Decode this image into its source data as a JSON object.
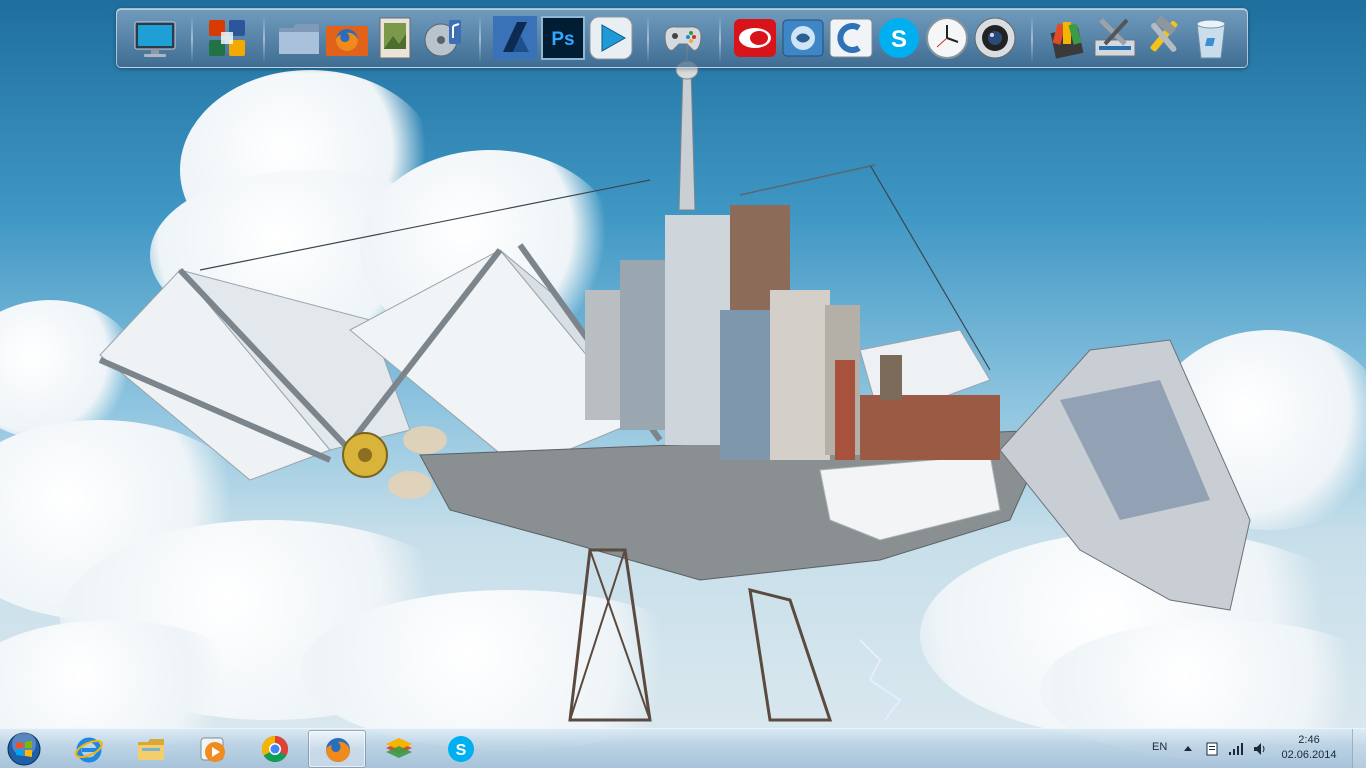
{
  "desktop": {
    "wallpaper": "floating-city-airship-wallpaper"
  },
  "dock": {
    "items": [
      {
        "name": "computer-monitor-icon"
      },
      {
        "name": "office-apps-icon"
      },
      {
        "name": "folder-icon"
      },
      {
        "name": "firefox-folder-icon"
      },
      {
        "name": "photo-viewer-icon"
      },
      {
        "name": "music-player-icon"
      },
      {
        "name": "autodesk-icon",
        "label": "A"
      },
      {
        "name": "photoshop-icon",
        "label": "Ps"
      },
      {
        "name": "media-player-icon"
      },
      {
        "name": "game-controller-icon"
      },
      {
        "name": "cloud-red-app-icon"
      },
      {
        "name": "finder-app-icon"
      },
      {
        "name": "ccleaner-icon"
      },
      {
        "name": "skype-icon",
        "label": "S"
      },
      {
        "name": "clock-icon"
      },
      {
        "name": "camera-lens-icon"
      },
      {
        "name": "stacked-apps-icon"
      },
      {
        "name": "system-tools-icon"
      },
      {
        "name": "hammer-wrench-icon"
      },
      {
        "name": "recycle-bin-icon"
      }
    ]
  },
  "taskbar": {
    "pinned": [
      {
        "name": "internet-explorer-icon"
      },
      {
        "name": "explorer-folder-icon"
      },
      {
        "name": "media-player-icon"
      },
      {
        "name": "chrome-icon"
      },
      {
        "name": "firefox-icon",
        "active": true
      },
      {
        "name": "bluestacks-icon"
      },
      {
        "name": "skype-icon",
        "label": "S"
      }
    ],
    "tray": {
      "language": "EN",
      "time": "2:46",
      "date": "02.06.2014"
    }
  },
  "colors": {
    "photoshop": "#001d34",
    "photoshop_text": "#31a8ff",
    "skype": "#00aff0",
    "red_app": "#d8141a"
  }
}
